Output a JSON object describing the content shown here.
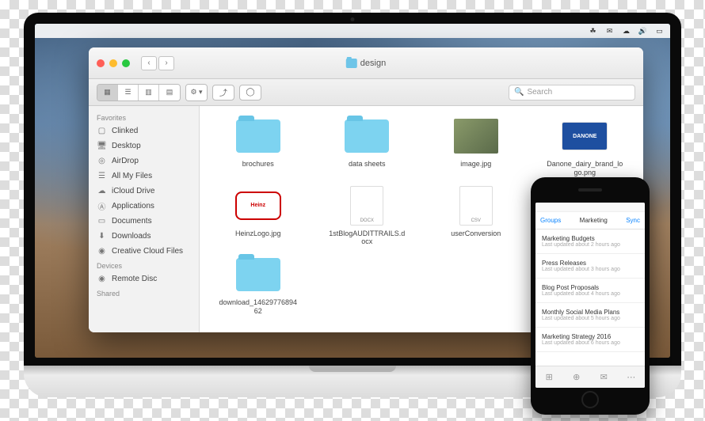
{
  "menubar": {
    "icons": [
      "leaf-icon",
      "chat-icon",
      "cloud-icon",
      "volume-icon",
      "monitor-icon"
    ]
  },
  "finder": {
    "title": "design",
    "search_placeholder": "Search",
    "sidebar": {
      "sections": [
        {
          "header": "Favorites",
          "items": [
            {
              "icon": "box-icon",
              "label": "Clinked"
            },
            {
              "icon": "desktop-icon",
              "label": "Desktop"
            },
            {
              "icon": "airdrop-icon",
              "label": "AirDrop"
            },
            {
              "icon": "files-icon",
              "label": "All My Files"
            },
            {
              "icon": "icloud-icon",
              "label": "iCloud Drive"
            },
            {
              "icon": "apps-icon",
              "label": "Applications"
            },
            {
              "icon": "documents-icon",
              "label": "Documents"
            },
            {
              "icon": "downloads-icon",
              "label": "Downloads"
            },
            {
              "icon": "creative-cloud-icon",
              "label": "Creative Cloud Files"
            }
          ]
        },
        {
          "header": "Devices",
          "items": [
            {
              "icon": "disc-icon",
              "label": "Remote Disc"
            }
          ]
        },
        {
          "header": "Shared",
          "items": []
        }
      ]
    },
    "files": [
      {
        "type": "folder",
        "name": "brochures"
      },
      {
        "type": "folder",
        "name": "data sheets"
      },
      {
        "type": "image",
        "name": "image.jpg"
      },
      {
        "type": "logo",
        "name": "Danone_dairy_brand_logo.png",
        "brand": "DANONE",
        "cls": "danone"
      },
      {
        "type": "logo",
        "name": "HeinzLogo.jpg",
        "brand": "Heinz",
        "cls": "heinz"
      },
      {
        "type": "doc",
        "name": "1stBlogAUDITTRAILS.docx",
        "ext": "DOCX"
      },
      {
        "type": "doc",
        "name": "userConversion",
        "ext": "CSV"
      },
      {
        "type": "blank",
        "name": ""
      },
      {
        "type": "folder",
        "name": "download_1462977689462"
      }
    ]
  },
  "phone": {
    "nav": {
      "left": "Groups",
      "center": "Marketing",
      "right": "Sync"
    },
    "rows": [
      {
        "title": "Marketing Budgets",
        "sub": "Last updated about 2 hours ago"
      },
      {
        "title": "Press Releases",
        "sub": "Last updated about 3 hours ago"
      },
      {
        "title": "Blog Post Proposals",
        "sub": "Last updated about 4 hours ago"
      },
      {
        "title": "Monthly Social Media Plans",
        "sub": "Last updated about 5 hours ago"
      },
      {
        "title": "Marketing Strategy 2016",
        "sub": "Last updated about 6 hours ago"
      }
    ]
  }
}
